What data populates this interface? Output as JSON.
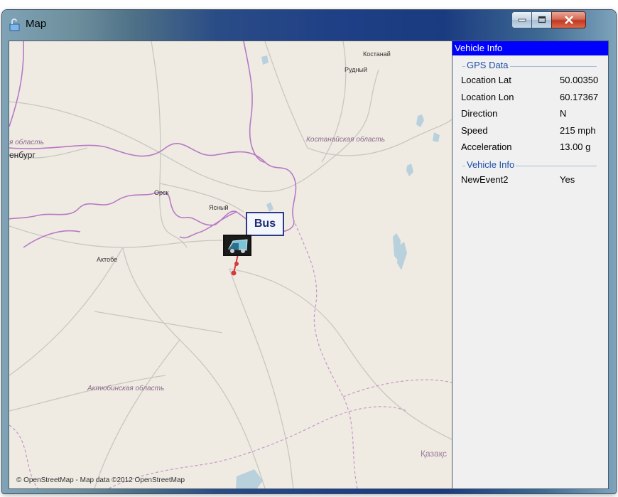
{
  "window": {
    "title": "Map",
    "controls": {
      "minimize": "minimize",
      "maximize": "maximize",
      "close": "close"
    }
  },
  "map": {
    "labels": {
      "kostanai": "Костанай",
      "rudnyi": "Рудный",
      "kostanai_oblast": "Костанайская область",
      "oblast_left": "я область",
      "orenburg": "енбург",
      "orsk": "Орск",
      "yasnyi": "Ясный",
      "aktobe": "Актобе",
      "aktobe_oblast": "Актюбинская область",
      "kazakh": "Қазақс"
    },
    "marker": {
      "label": "Bus"
    },
    "attribution": "© OpenStreetMap - Map data ©2012 OpenStreetMap"
  },
  "panel": {
    "header": "Vehicle Info",
    "groups": [
      {
        "title": "GPS Data",
        "rows": [
          {
            "key": "Location Lat",
            "value": "50.00350"
          },
          {
            "key": "Location Lon",
            "value": "60.17367"
          },
          {
            "key": "Direction",
            "value": "N"
          },
          {
            "key": "Speed",
            "value": "215 mph"
          },
          {
            "key": "Acceleration",
            "value": "13.00 g"
          }
        ]
      },
      {
        "title": "Vehicle Info",
        "rows": [
          {
            "key": "NewEvent2",
            "value": "Yes"
          }
        ]
      }
    ]
  }
}
